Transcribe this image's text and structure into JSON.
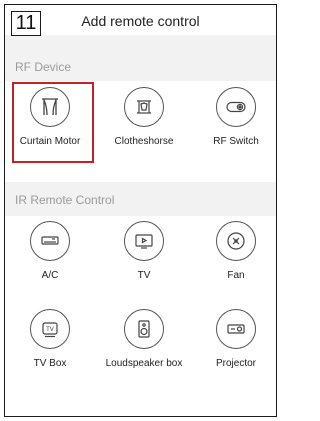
{
  "step_badge": "11",
  "header": {
    "title": "Add remote control"
  },
  "rf_section": {
    "title": "RF Device",
    "items": [
      {
        "label": "Curtain Motor",
        "icon": "curtain-icon",
        "selected": true
      },
      {
        "label": "Clotheshorse",
        "icon": "clotheshorse-icon"
      },
      {
        "label": "RF Switch",
        "icon": "rf-switch-icon"
      }
    ]
  },
  "ir_section": {
    "title": "IR Remote Control",
    "items": [
      {
        "label": "A/C",
        "icon": "air-conditioner-icon"
      },
      {
        "label": "TV",
        "icon": "tv-icon"
      },
      {
        "label": "Fan",
        "icon": "fan-icon"
      },
      {
        "label": "TV Box",
        "icon": "tv-box-icon"
      },
      {
        "label": "Loudspeaker box",
        "icon": "loudspeaker-icon"
      },
      {
        "label": "Projector",
        "icon": "projector-icon"
      }
    ]
  },
  "colors": {
    "highlight": "#c8202a",
    "section_bg": "#f2f2f2",
    "section_text": "#9a9a9a"
  }
}
